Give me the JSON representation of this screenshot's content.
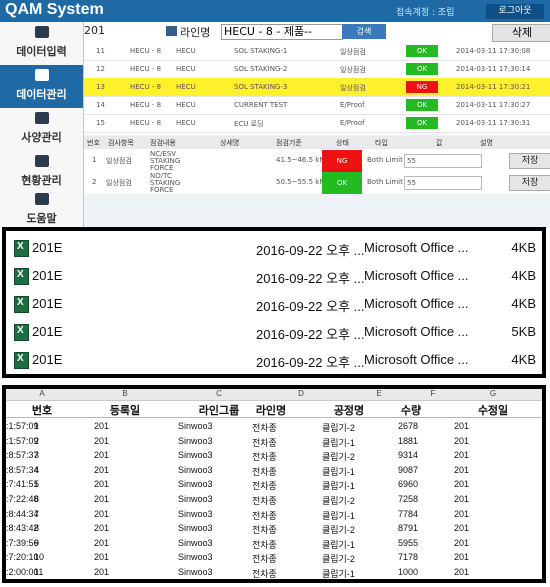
{
  "app": {
    "title": "QAM System",
    "login_info": "접속계정 : 조립",
    "logout_label": "로그아웃"
  },
  "sidebar": {
    "items": [
      {
        "label": "데이터입력",
        "icon": "data-input-icon",
        "active": false
      },
      {
        "label": "데이터관리",
        "icon": "data-manage-icon",
        "active": true
      },
      {
        "label": "사양관리",
        "icon": "spec-icon",
        "active": false
      },
      {
        "label": "현황관리",
        "icon": "status-icon",
        "active": false
      },
      {
        "label": "도움말",
        "icon": "help-icon",
        "active": false
      }
    ]
  },
  "toolbar": {
    "code_value": "201",
    "line_label": "라인명",
    "line_value": "HECU - 8 - 제품--",
    "search_label": "검색",
    "delete_label": "삭제"
  },
  "grid": {
    "rows": [
      {
        "no": "11",
        "line": "HECU - 8",
        "product": "HECU",
        "item": "SOL STAKING-1",
        "type": "일상점검",
        "status": "OK",
        "status_color": "#22bb22",
        "time": "2014-03-11 17:30:08",
        "highlight": false
      },
      {
        "no": "12",
        "line": "HECU - 8",
        "product": "HECU",
        "item": "SOL STAKING-2",
        "type": "일상점검",
        "status": "OK",
        "status_color": "#22bb22",
        "time": "2014-03-11 17:30:14",
        "highlight": false
      },
      {
        "no": "13",
        "line": "HECU - 8",
        "product": "HECU",
        "item": "SOL STAKING-3",
        "type": "일상점검",
        "status": "NG",
        "status_color": "#ee1111",
        "time": "2014-03-11 17:30:21",
        "highlight": true
      },
      {
        "no": "14",
        "line": "HECU - 8",
        "product": "HECU",
        "item": "CURRENT TEST",
        "type": "E/Proof",
        "status": "OK",
        "status_color": "#22bb22",
        "time": "2014-03-11 17:30:27",
        "highlight": false
      },
      {
        "no": "15",
        "line": "HECU - 8",
        "product": "HECU",
        "item": "ECU 로딩",
        "type": "E/Proof",
        "status": "OK",
        "status_color": "#22bb22",
        "time": "2014-03-11 17:30:31",
        "highlight": false
      }
    ]
  },
  "detail": {
    "headers": [
      "번호",
      "검사항목",
      "점검내용",
      "상세명",
      "점검기준",
      "상태",
      "타입",
      "값",
      "설명"
    ],
    "rows": [
      {
        "no": "1",
        "item": "일상점검",
        "content": "NC/ESV STAKING FORCE",
        "standard": "41.5~46.5 kN",
        "status": "NG",
        "status_color": "#ee1111",
        "type": "Both Limit",
        "value": "55",
        "save": "저장"
      },
      {
        "no": "2",
        "item": "일상점검",
        "content": "NO/TC STAKING FORCE",
        "standard": "50.5~55.5 kN",
        "status": "OK",
        "status_color": "#22bb22",
        "type": "Both Limit",
        "value": "55",
        "save": "저장"
      }
    ]
  },
  "files": [
    {
      "name": "201E",
      "date": "2016-09-22 오후 ...",
      "type": "Microsoft Office ...",
      "size": "4KB"
    },
    {
      "name": "201E",
      "date": "2016-09-22 오후 ...",
      "type": "Microsoft Office ...",
      "size": "4KB"
    },
    {
      "name": "201E",
      "date": "2016-09-22 오후 ...",
      "type": "Microsoft Office ...",
      "size": "4KB"
    },
    {
      "name": "201E",
      "date": "2016-09-22 오후 ...",
      "type": "Microsoft Office ...",
      "size": "5KB"
    },
    {
      "name": "201E",
      "date": "2016-09-22 오후 ...",
      "type": "Microsoft Office ...",
      "size": "4KB"
    }
  ],
  "sheet": {
    "col_letters": [
      "A",
      "B",
      "C",
      "D",
      "E",
      "F",
      "G"
    ],
    "headers": [
      "번호",
      "등록일",
      "라인그룹",
      "라인명",
      "공정명",
      "수량",
      "수정일"
    ],
    "rows": [
      [
        "1",
        "201",
        "Sinwoo3",
        "전차종",
        "클립기-2",
        "2678",
        "201",
        ":1:57:09"
      ],
      [
        "2",
        "201",
        "Sinwoo3",
        "전차종",
        "클립기-1",
        "1881",
        "201",
        ":1:57:09"
      ],
      [
        "3",
        "201",
        "Sinwoo3",
        "전차종",
        "클립기-2",
        "9314",
        "201",
        ":8:57:37"
      ],
      [
        "4",
        "201",
        "Sinwoo3",
        "전차종",
        "클립기-1",
        "9087",
        "201",
        ":8:57:34"
      ],
      [
        "5",
        "201",
        "Sinwoo3",
        "전차종",
        "클립기-1",
        "6960",
        "201",
        ":7:41:51"
      ],
      [
        "6",
        "201",
        "Sinwoo3",
        "전차종",
        "클립기-2",
        "7258",
        "201",
        ":7:22:48"
      ],
      [
        "7",
        "201",
        "Sinwoo3",
        "전차종",
        "클립기-1",
        "7784",
        "201",
        ":8:44:34"
      ],
      [
        "8",
        "201",
        "Sinwoo3",
        "전차종",
        "클립기-2",
        "8791",
        "201",
        ":8:43:42"
      ],
      [
        "9",
        "201",
        "Sinwoo3",
        "전차종",
        "클립기-1",
        "5955",
        "201",
        ":7:39:56"
      ],
      [
        "10",
        "201",
        "Sinwoo3",
        "전차종",
        "클립기-2",
        "7178",
        "201",
        ":7:20:10"
      ],
      [
        "11",
        "201",
        "Sinwoo3",
        "전차종",
        "클립기-1",
        "1000",
        "201",
        ":2:00:00"
      ]
    ]
  }
}
